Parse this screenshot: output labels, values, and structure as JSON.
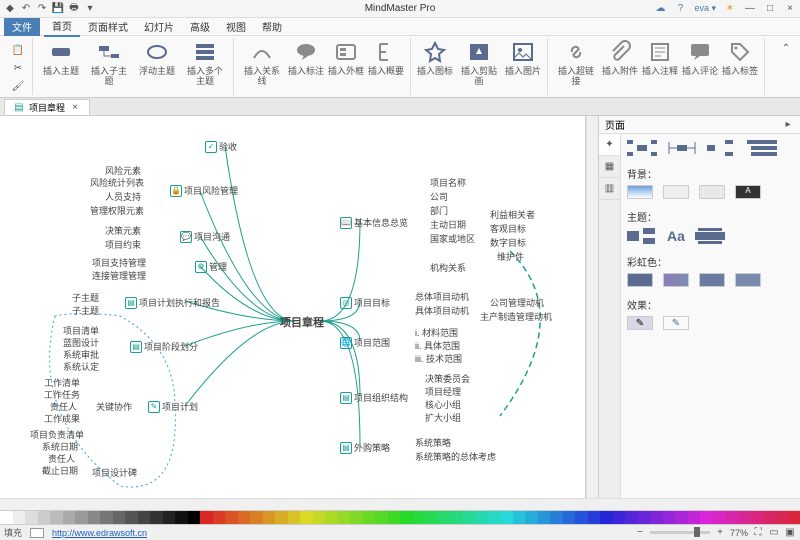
{
  "title": "MindMaster Pro",
  "menu": {
    "file": "文件",
    "tabs": [
      "首页",
      "页面样式",
      "幻灯片",
      "高级",
      "视图",
      "帮助"
    ]
  },
  "ribbon": {
    "g1": [
      "插入主题",
      "插入子主题",
      "浮动主题",
      "插入多个主题"
    ],
    "g2": [
      "插入关系线",
      "插入标注",
      "插入外框",
      "插入概要"
    ],
    "g3": [
      "插入图标",
      "插入剪贴画",
      "插入图片"
    ],
    "g4": [
      "插入超链接",
      "插入附件",
      "插入注释",
      "插入评论",
      "插入标签"
    ]
  },
  "doctab": "项目章程",
  "side": {
    "hdr": "页面",
    "labels": {
      "bg": "背景：",
      "theme": "主题：",
      "rainbow": "彩虹色：",
      "effect": "效果："
    }
  },
  "status": {
    "fill": "填充",
    "url": "http://www.edrawsoft.cn",
    "zoom": "77%"
  },
  "nodes": {
    "root": "项目章程",
    "l1": [
      "验收",
      "项目风险管理",
      "项目沟通",
      "管理",
      "项目计划执行和报告",
      "项目阶段划分",
      "项目计划"
    ],
    "l1r": [
      "基本信息总览",
      "项目目标",
      "项目范围",
      "项目组织结构",
      "外购策略"
    ],
    "l2a": [
      "风险元素",
      "风险统计列表",
      "人员支持",
      "管理权限元素"
    ],
    "l2b": [
      "决策元素",
      "项目约束"
    ],
    "l2c": [
      "项目支持管理",
      "连接管理管理"
    ],
    "l2d": [
      "子主题",
      "子主题"
    ],
    "l2e": [
      "项目清单",
      "蓝图设计",
      "系统审批",
      "系统认定"
    ],
    "l2f": [
      "工作清单",
      "工作任务",
      "责任人",
      "工作成果"
    ],
    "l2g": [
      "项目负责清单",
      "系统日期",
      "责任人",
      "截止日期"
    ],
    "l2h": [
      "关键协作"
    ],
    "l2i": [
      "项目设计碑"
    ],
    "r2a": [
      "项目名称",
      "公司",
      "部门",
      "主动日期",
      "国家或地区",
      "机构关系"
    ],
    "r2b": [
      "利益相关者",
      "客观目标",
      "数字目标",
      "维护件"
    ],
    "r2c": [
      "总体项目动机",
      "具体项目动机"
    ],
    "r2d": [
      "公司管理动机",
      "主产制造管理动机"
    ],
    "r2e": [
      "i. 材料范围",
      "ii. 具体范围",
      "iii. 技术范围"
    ],
    "r2f": [
      "决策委员会",
      "项目经理",
      "核心小组",
      "扩大小组"
    ],
    "r2g": [
      "系统策略",
      "系统策略的总体考虑"
    ]
  }
}
